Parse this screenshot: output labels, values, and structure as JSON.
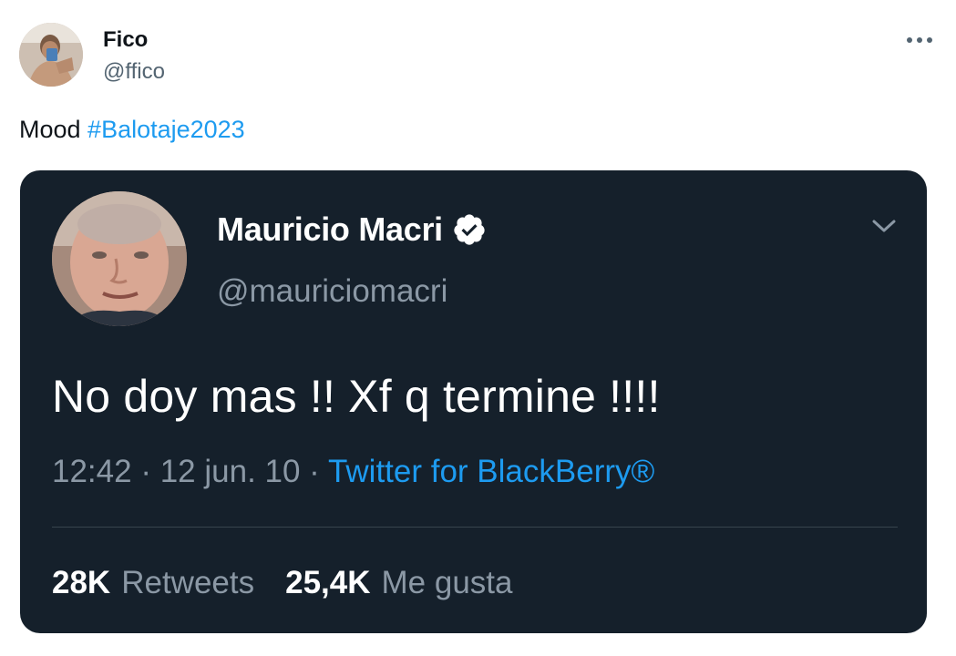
{
  "author": {
    "name": "Fico",
    "handle": "@ffico",
    "avatar_icon": "user-photo-avatar"
  },
  "more_icon": "more-horizontal-icon",
  "tweet": {
    "text": "Mood ",
    "hashtag": "#Balotaje2023"
  },
  "quoted": {
    "name": "Mauricio Macri",
    "verified_icon": "verified-badge-icon",
    "handle": "@mauriciomacri",
    "body": "No doy mas !! Xf q termine !!!!",
    "time": "12:42",
    "separator1": " · ",
    "date": "12 jun. 10",
    "separator2": " · ",
    "source": "Twitter for BlackBerry®",
    "retweets_count": "28K",
    "retweets_label": "Retweets",
    "likes_count": "25,4K",
    "likes_label": "Me gusta",
    "chevron_icon": "chevron-down-icon"
  },
  "colors": {
    "accent": "#1d9bf0",
    "card_bg": "#15202b",
    "muted": "#8b98a5"
  }
}
